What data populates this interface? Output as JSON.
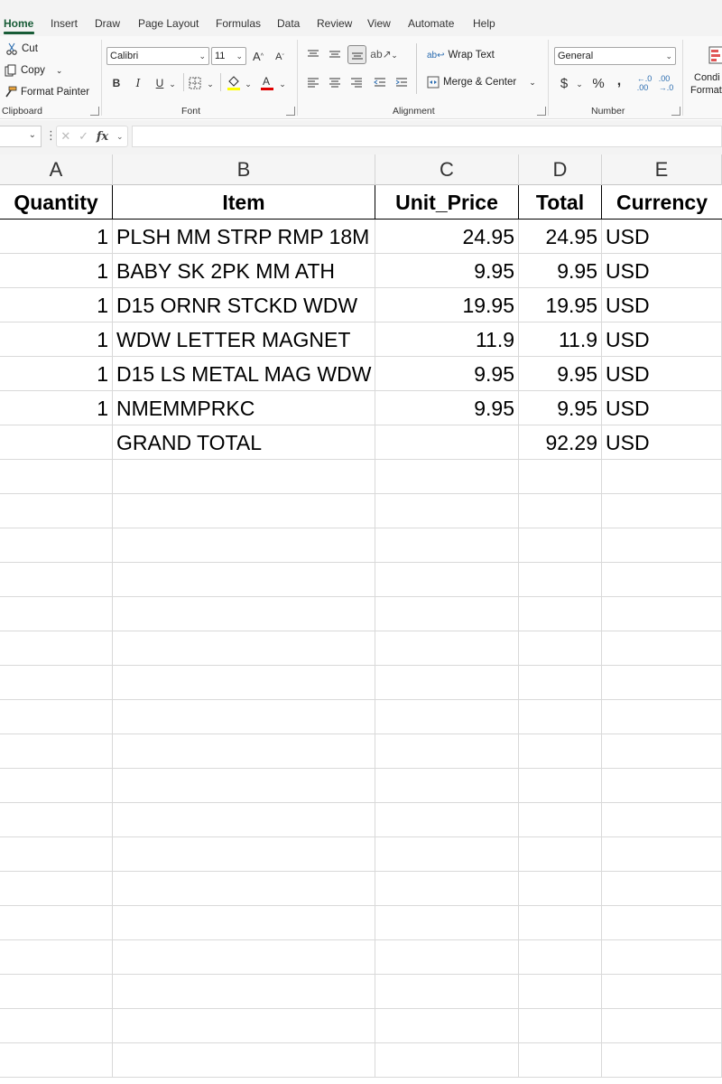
{
  "ribbon_tabs": [
    "Home",
    "Insert",
    "Draw",
    "Page Layout",
    "Formulas",
    "Data",
    "Review",
    "View",
    "Automate",
    "Help"
  ],
  "clipboard": {
    "cut_label": "Cut",
    "copy_label": "Copy",
    "format_painter_label": "Format Painter",
    "group_label": "Clipboard"
  },
  "font": {
    "font_name": "Calibri",
    "font_size": "11",
    "bold": "B",
    "italic": "I",
    "underline": "U",
    "group_label": "Font"
  },
  "alignment": {
    "wrap_text_label": "Wrap Text",
    "merge_center_label": "Merge & Center",
    "group_label": "Alignment"
  },
  "number": {
    "format": "General",
    "currency_symbol": "$",
    "percent_symbol": "%",
    "comma_symbol": ",",
    "group_label": "Number"
  },
  "styles": {
    "conditional_formatting_label_1": "Condi",
    "conditional_formatting_label_2": "Format"
  },
  "formula_bar": {
    "fx_label": "fx",
    "value": ""
  },
  "columns": [
    "A",
    "B",
    "C",
    "D",
    "E"
  ],
  "sheet": {
    "headers": [
      "Quantity",
      "Item",
      "Unit_Price",
      "Total",
      "Currency"
    ],
    "rows": [
      {
        "quantity": "1",
        "item": "PLSH MM STRP RMP 18M",
        "unit_price": "24.95",
        "total": "24.95",
        "currency": "USD"
      },
      {
        "quantity": "1",
        "item": "BABY SK 2PK MM ATH",
        "unit_price": "9.95",
        "total": "9.95",
        "currency": "USD"
      },
      {
        "quantity": "1",
        "item": "D15 ORNR STCKD WDW",
        "unit_price": "19.95",
        "total": "19.95",
        "currency": "USD"
      },
      {
        "quantity": "1",
        "item": "WDW LETTER MAGNET",
        "unit_price": "11.9",
        "total": "11.9",
        "currency": "USD"
      },
      {
        "quantity": "1",
        "item": "D15 LS METAL MAG WDW",
        "unit_price": "9.95",
        "total": "9.95",
        "currency": "USD"
      },
      {
        "quantity": "1",
        "item": "NMEMMPRKC",
        "unit_price": "9.95",
        "total": "9.95",
        "currency": "USD"
      }
    ],
    "grand_total": {
      "label": "GRAND TOTAL",
      "total": "92.29",
      "currency": "USD"
    }
  },
  "colors": {
    "accent": "#185c37",
    "font_color_underline": "#e00000",
    "highlight_color": "#ffff00"
  }
}
